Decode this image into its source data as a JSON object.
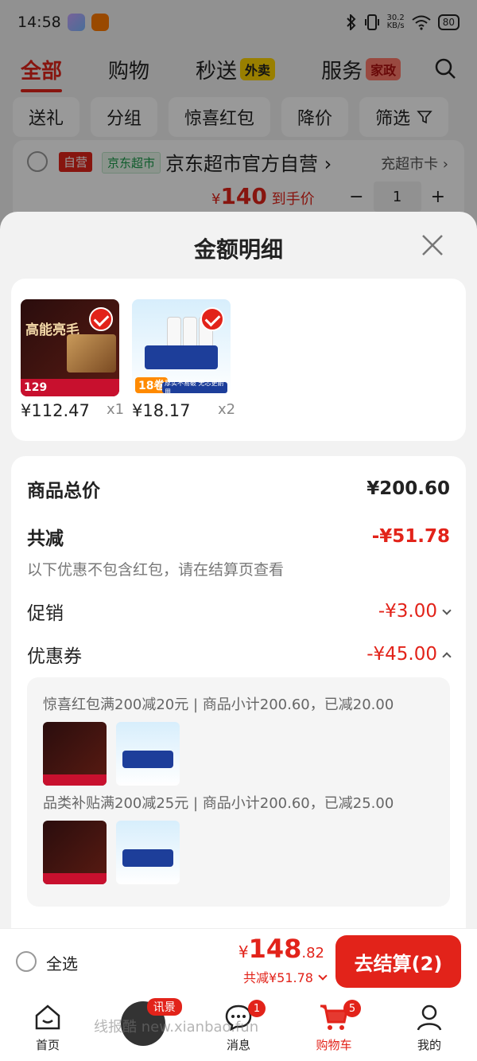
{
  "status": {
    "time": "14:58",
    "speed_top": "30.2",
    "speed_unit": "KB/s",
    "battery": "80"
  },
  "topnav": {
    "tabs": [
      {
        "label": "全部"
      },
      {
        "label": "购物"
      },
      {
        "label": "秒送",
        "badge": "外卖"
      },
      {
        "label": "服务",
        "badge": "家政"
      }
    ]
  },
  "chips": [
    "送礼",
    "分组",
    "惊喜红包",
    "降价",
    "筛选"
  ],
  "store": {
    "tag_self": "自营",
    "tag_market": "京东超市",
    "name": "京东超市官方自营",
    "card": "充超市卡",
    "price_symbol": "¥",
    "price": "140",
    "price_suffix": "到手价",
    "qty": "1"
  },
  "sheet": {
    "title": "金额明细",
    "items": [
      {
        "price": "¥112.47",
        "qty": "x1",
        "thumb_title": "高能亮毛",
        "thumb_price": "129"
      },
      {
        "price": "¥18.17",
        "qty": "x2",
        "thumb_badge": "18卷",
        "thumb_strip": "厚实不易破 无芯更耐用"
      }
    ],
    "summary": {
      "total_label": "商品总价",
      "total_value": "¥200.60",
      "reduce_label": "共减",
      "reduce_value": "-¥51.78",
      "note": "以下优惠不包含红包，请在结算页查看",
      "promo_label": "促销",
      "promo_value": "-¥3.00",
      "coupon_label": "优惠券",
      "coupon_value": "-¥45.00",
      "coupon_lines": [
        "惊喜红包满200减20元 | 商品小计200.60，已减20.00",
        "品类补贴满200减25元 | 商品小计200.60，已减25.00"
      ]
    }
  },
  "checkout": {
    "select_all": "全选",
    "currency": "¥",
    "total_int": "148",
    "total_dec": ".82",
    "saved": "共减¥51.78",
    "button": "去结算(2)"
  },
  "tabbar": {
    "items": [
      {
        "label": "首页"
      },
      {
        "label": "",
        "promo": "讯景"
      },
      {
        "label": "消息",
        "badge": "1"
      },
      {
        "label": "购物车",
        "badge": "5"
      },
      {
        "label": "我的"
      }
    ]
  },
  "watermark": "线报酷 new.xianbao.fun",
  "colors": {
    "accent": "#e2231a",
    "background": "#f2f2f2"
  }
}
